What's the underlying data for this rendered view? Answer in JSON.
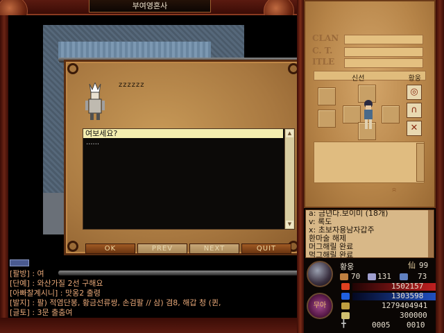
{
  "window": {
    "title": "부여영혼사"
  },
  "dialog": {
    "npc_speech": "zzzzzz",
    "lines": [
      "여보세요?",
      "......"
    ],
    "buttons": {
      "ok": "OK",
      "prev": "PREV",
      "next": "NEXT",
      "quit": "QUIT"
    }
  },
  "character": {
    "labels": {
      "clan": "CLAN",
      "ct": "C. T.",
      "title": "ITLE"
    },
    "slot_left": "신선",
    "slot_right": "황웅",
    "equip_icons": [
      "ring-icon",
      "boots-icon",
      "gloves-icon"
    ]
  },
  "items": [
    "a: 금년다.보이미 (18개)",
    "v: 록도",
    "x: 초보자용남자갑주",
    "환마술 해제",
    "머그해릴 완료",
    "먹그해릴 완료"
  ],
  "chat": [
    "[팔방] : 여",
    "[단예] : 와산가질 2선 구해요",
    "[아빠찰계시니] : 맛옹2 출령",
    "[발지] : 팔) 적염단봉, 황금선류쌍, 손검팔 // 삼) 겸8, 해갑 청 (퀸,",
    "[글토] : 3문 출춤여"
  ],
  "status": {
    "name": "황웅",
    "level": "99",
    "stat_a": "70",
    "stat_b": "131",
    "stat_c": "73",
    "hp": "1502157",
    "mp": "1303598",
    "exp": "1279404941",
    "gold": "300000",
    "coord_x": "0005",
    "coord_y": "0010",
    "orb_label": "무아",
    "colors": {
      "hp": "#c02020",
      "mp": "#2050c0",
      "exp": "#c0a040"
    }
  }
}
